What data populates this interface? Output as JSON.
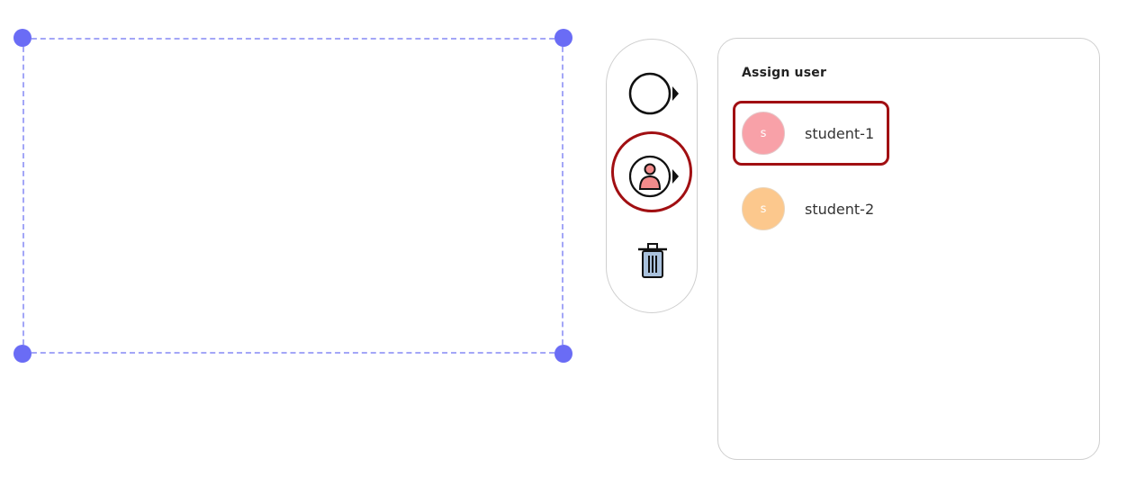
{
  "panel": {
    "title": "Assign user",
    "users": [
      {
        "initial": "s",
        "name": "student-1",
        "color": "#f8a1a8",
        "highlighted": true
      },
      {
        "initial": "s",
        "name": "student-2",
        "color": "#fcc88d",
        "highlighted": false
      }
    ]
  },
  "toolbar": {
    "tools": [
      {
        "icon": "circle-shape-icon"
      },
      {
        "icon": "assign-user-icon",
        "highlighted": true
      },
      {
        "icon": "trash-icon"
      }
    ]
  },
  "colors": {
    "selection_border": "#a3a6f7",
    "selection_handle": "#6a6cf5",
    "highlight": "#a10f12"
  }
}
